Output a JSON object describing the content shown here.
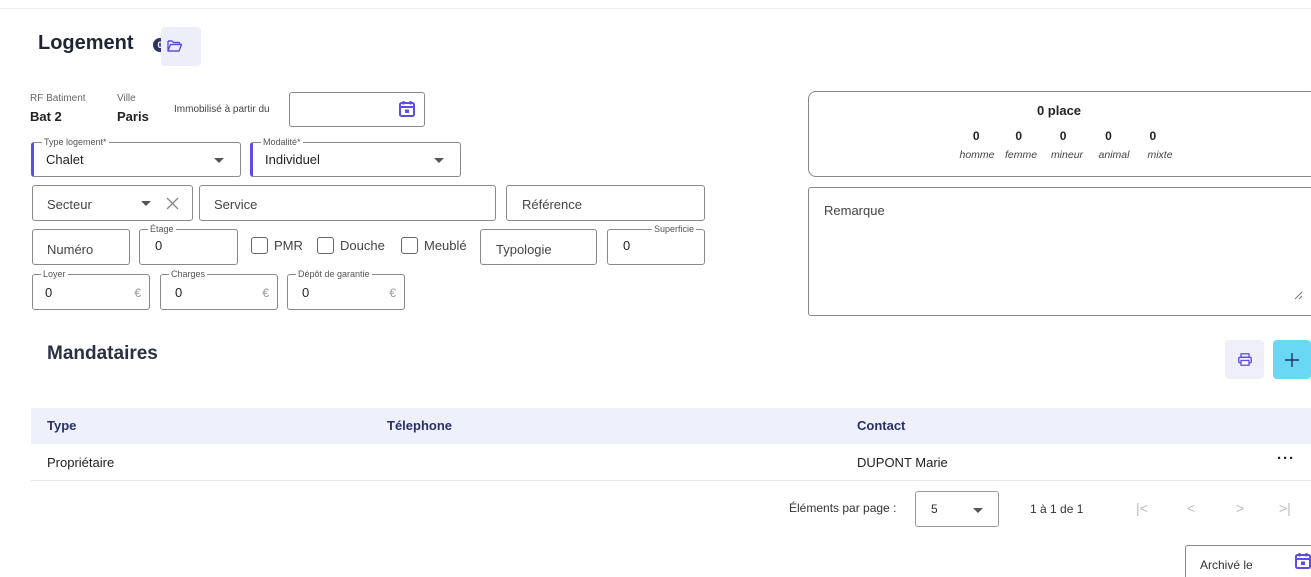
{
  "logement": {
    "title": "Logement",
    "count_badge": "0",
    "rf_batiment_label": "RF Batiment",
    "rf_batiment_value": "Bat 2",
    "ville_label": "Ville",
    "ville_value": "Paris",
    "immobilise_label": "Immobilisé à partir du",
    "immobilise_value": "",
    "type_logement_label": "Type logement*",
    "type_logement_value": "Chalet",
    "modalite_label": "Modalité*",
    "modalite_value": "Individuel",
    "secteur_placeholder": "Secteur",
    "service_placeholder": "Service",
    "reference_placeholder": "Référence",
    "numero_placeholder": "Numéro",
    "etage_label": "Étage",
    "etage_value": "0",
    "pmr_label": "PMR",
    "douche_label": "Douche",
    "meuble_label": "Meublé",
    "typologie_placeholder": "Typologie",
    "superficie_label": "Superficie",
    "superficie_value": "0",
    "loyer_label": "Loyer",
    "loyer_value": "0",
    "charges_label": "Charges",
    "charges_value": "0",
    "depot_label": "Dépôt de garantie",
    "depot_value": "0",
    "currency": "€"
  },
  "places": {
    "title": "0 place",
    "items": [
      {
        "count": "0",
        "label": "homme"
      },
      {
        "count": "0",
        "label": "femme"
      },
      {
        "count": "0",
        "label": "mineur"
      },
      {
        "count": "0",
        "label": "animal"
      },
      {
        "count": "0",
        "label": "mixte"
      }
    ]
  },
  "remarque": {
    "label": "Remarque",
    "value": ""
  },
  "mandataires": {
    "title": "Mandataires",
    "columns": [
      "Type",
      "Télephone",
      "Contact"
    ],
    "rows": [
      {
        "type": "Propriétaire",
        "telephone": "",
        "contact": "DUPONT Marie",
        "actions": "···"
      }
    ]
  },
  "pagination": {
    "label": "Éléments par page :",
    "per_page": "5",
    "range": "1 à 1 de 1"
  },
  "archive": {
    "label": "Archivé le"
  },
  "colors": {
    "accent": "#5c4ee5",
    "table_header_bg": "#eef0fb",
    "add_button_bg": "#6ad8f5"
  }
}
